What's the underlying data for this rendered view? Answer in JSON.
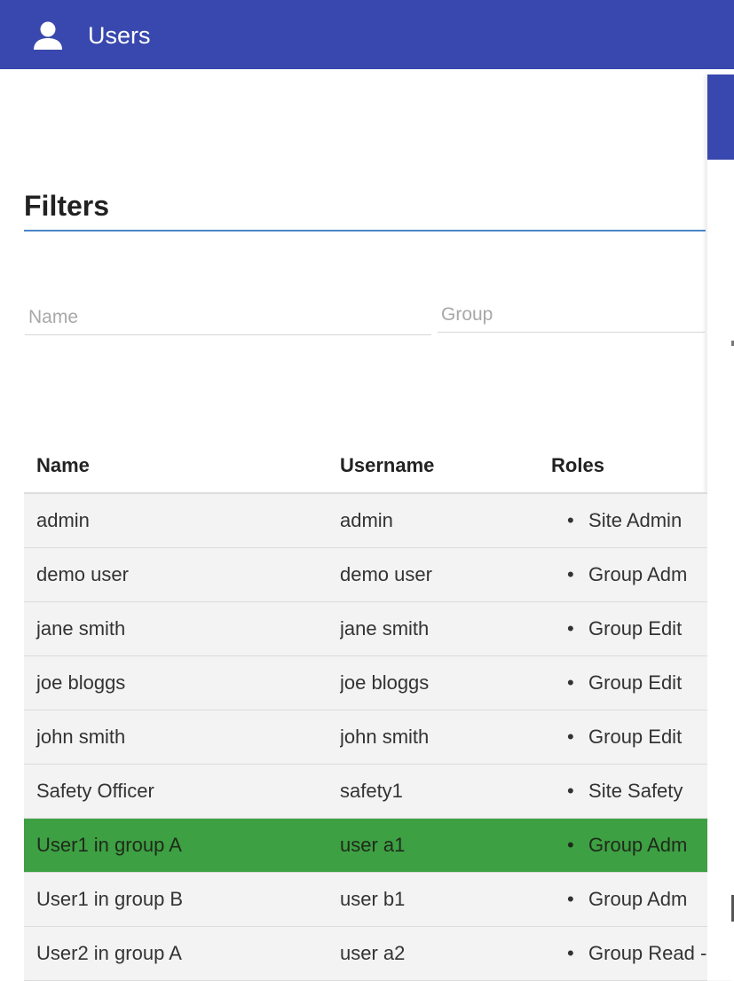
{
  "header": {
    "title": "Users",
    "icon": "user-icon",
    "background_color": "#3848ae"
  },
  "filters": {
    "heading": "Filters",
    "name_placeholder": "Name",
    "name_value": "",
    "group_placeholder": "Group",
    "group_value": ""
  },
  "table": {
    "columns": [
      "Name",
      "Username",
      "Roles"
    ],
    "rows": [
      {
        "name": "admin",
        "username": "admin",
        "role": "Site Admin"
      },
      {
        "name": "demo user",
        "username": "demo user",
        "role": "Group Adm"
      },
      {
        "name": "jane smith",
        "username": "jane smith",
        "role": "Group Edit"
      },
      {
        "name": "joe bloggs",
        "username": "joe bloggs",
        "role": "Group Edit"
      },
      {
        "name": "john smith",
        "username": "john smith",
        "role": "Group Edit"
      },
      {
        "name": "Safety Officer",
        "username": "safety1",
        "role": "Site Safety"
      },
      {
        "name": "User1 in group A",
        "username": "user a1",
        "role": "Group Adm"
      },
      {
        "name": "User1 in group B",
        "username": "user b1",
        "role": "Group Adm"
      },
      {
        "name": "User2 in group A",
        "username": "user a2",
        "role": "Group Read -"
      }
    ],
    "selected_row_index": 6,
    "selected_color": "#3da043"
  }
}
